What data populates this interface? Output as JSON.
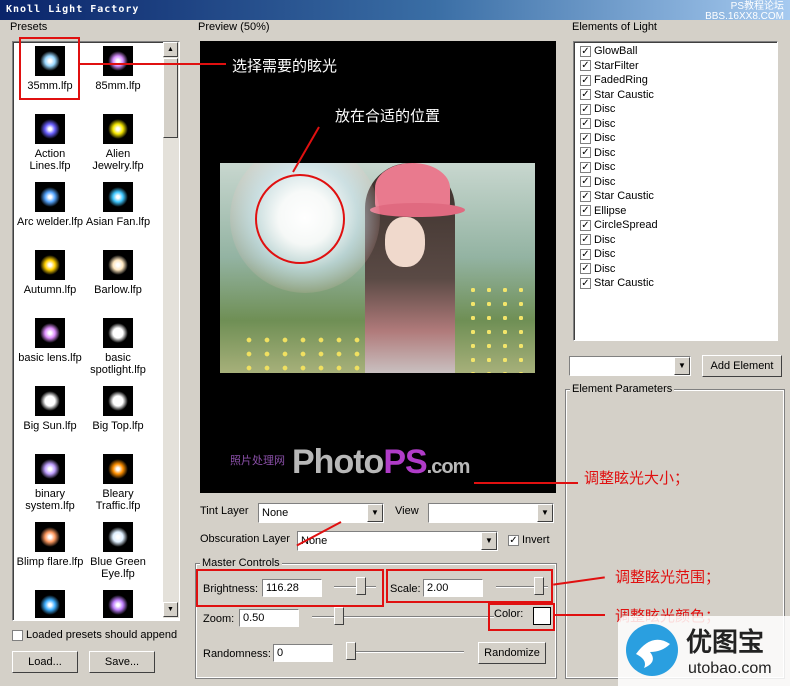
{
  "app": {
    "title": "Knoll Light Factory",
    "top_watermark_1": "PS教程论坛",
    "top_watermark_2": "BBS.16XX8.COM"
  },
  "presets": {
    "label": "Presets",
    "items": [
      {
        "label": "35mm.lfp",
        "glow": "#9ad8ff"
      },
      {
        "label": "85mm.lfp",
        "glow": "#d890ff"
      },
      {
        "label": "Action Lines.lfp",
        "glow": "#6a60ff"
      },
      {
        "label": "Alien Jewelry.lfp",
        "glow": "#f6e800"
      },
      {
        "label": "Arc welder.lfp",
        "glow": "#56a6ff"
      },
      {
        "label": "Asian Fan.lfp",
        "glow": "#40c8ff"
      },
      {
        "label": "Autumn.lfp",
        "glow": "#ffd000"
      },
      {
        "label": "Barlow.lfp",
        "glow": "#ffe7c0"
      },
      {
        "label": "basic lens.lfp",
        "glow": "#e090ff"
      },
      {
        "label": "basic spotlight.lfp",
        "glow": "#ffffff"
      },
      {
        "label": "Big Sun.lfp",
        "glow": "#ffffff"
      },
      {
        "label": "Big Top.lfp",
        "glow": "#ffffff"
      },
      {
        "label": "binary system.lfp",
        "glow": "#c0a0ff"
      },
      {
        "label": "Bleary Traffic.lfp",
        "glow": "#ff9000"
      },
      {
        "label": "Blimp flare.lfp",
        "glow": "#ff9a60"
      },
      {
        "label": "Blue Green Eye.lfp",
        "glow": "#e0f0ff"
      },
      {
        "label": "",
        "glow": "#40b0ff"
      },
      {
        "label": "",
        "glow": "#c080ff"
      }
    ],
    "append_label": "Loaded presets should append",
    "load_label": "Load...",
    "save_label": "Save..."
  },
  "preview": {
    "label": "Preview (50%)",
    "watermark_cn": "照片处理网",
    "watermark_photo": "Photo",
    "watermark_ps": "PS",
    "watermark_com": ".com"
  },
  "tint": {
    "label": "Tint Layer",
    "value": "None"
  },
  "view": {
    "label": "View",
    "value": ""
  },
  "obscuration": {
    "label": "Obscuration Layer",
    "value": "None",
    "invert_label": "Invert"
  },
  "master": {
    "label": "Master Controls",
    "brightness_label": "Brightness:",
    "brightness_value": "116.28",
    "scale_label": "Scale:",
    "scale_value": "2.00",
    "color_label": "Color:",
    "zoom_label": "Zoom:",
    "zoom_value": "0.50",
    "randomness_label": "Randomness:",
    "randomness_value": "0",
    "randomize_label": "Randomize"
  },
  "elements": {
    "label": "Elements of Light",
    "items": [
      "GlowBall",
      "StarFilter",
      "FadedRing",
      "Star Caustic",
      "Disc",
      "Disc",
      "Disc",
      "Disc",
      "Disc",
      "Disc",
      "Star Caustic",
      "Ellipse",
      "CircleSpread",
      "Disc",
      "Disc",
      "Disc",
      "Star Caustic"
    ],
    "add_label": "Add Element",
    "params_label": "Element Parameters"
  },
  "annotations": {
    "choose_flare": "选择需要的眩光",
    "place_position": "放在合适的位置",
    "adjust_size": "调整眩光大小；",
    "adjust_range": "调整眩光范围；",
    "adjust_color": "调整眩光颜色；"
  },
  "brand": {
    "cn": "优图宝",
    "url": "utobao.com"
  }
}
